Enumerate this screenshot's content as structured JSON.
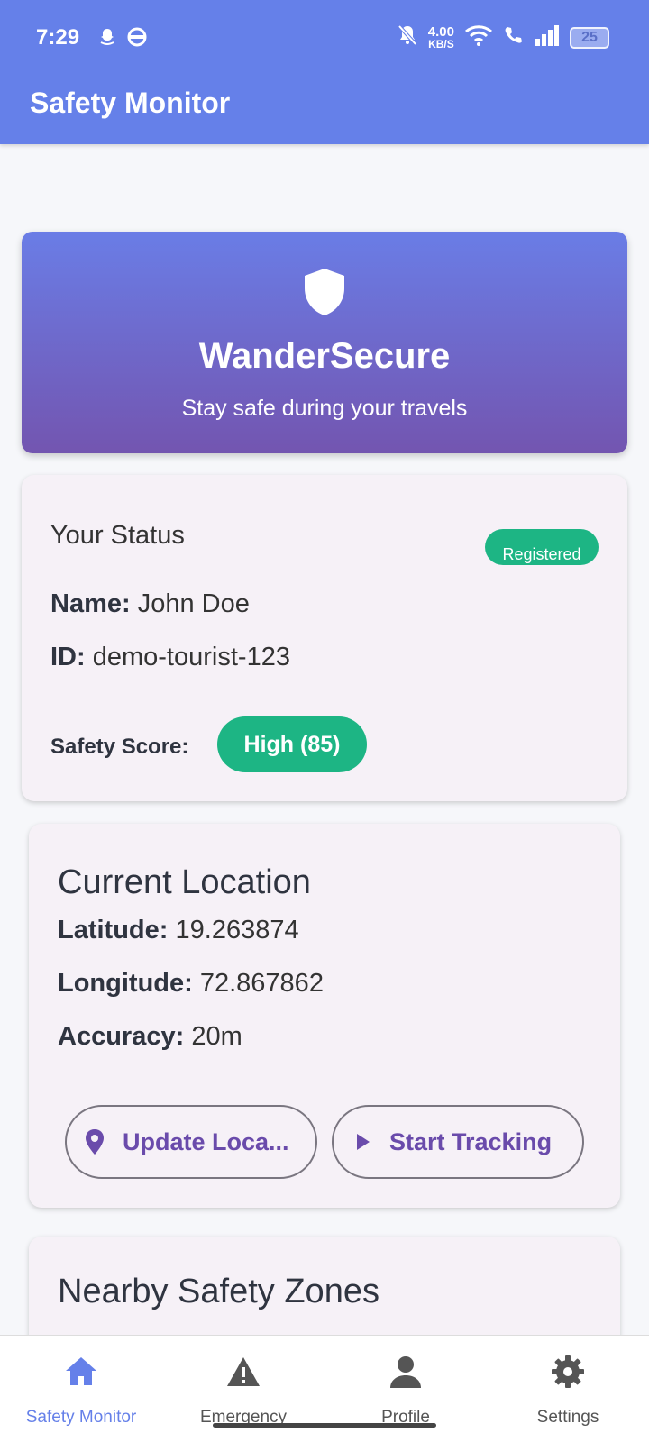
{
  "status_bar": {
    "time": "7:29",
    "net_speed_value": "4.00",
    "net_speed_unit": "KB/S",
    "battery": "25",
    "network_type": "5"
  },
  "app_bar": {
    "title": "Safety Monitor"
  },
  "hero": {
    "title": "WanderSecure",
    "subtitle": "Stay safe during your travels",
    "icon": "shield-icon"
  },
  "status_card": {
    "heading": "Your Status",
    "badge": "Registered",
    "name_label": "Name:",
    "name_value": "John Doe",
    "id_label": "ID:",
    "id_value": "demo-tourist-123",
    "score_label": "Safety Score:",
    "score_value": "High (85)"
  },
  "location_card": {
    "heading": "Current Location",
    "latitude_label": "Latitude:",
    "latitude_value": "19.263874",
    "longitude_label": "Longitude:",
    "longitude_value": "72.867862",
    "accuracy_label": "Accuracy:",
    "accuracy_value": "20m",
    "update_button": "Update Loca...",
    "track_button": "Start Tracking"
  },
  "zones_card": {
    "heading": "Nearby Safety Zones"
  },
  "bottom_nav": {
    "items": [
      {
        "label": "Safety Monitor",
        "icon": "home-icon",
        "active": true
      },
      {
        "label": "Emergency",
        "icon": "warning-icon",
        "active": false
      },
      {
        "label": "Profile",
        "icon": "person-icon",
        "active": false
      },
      {
        "label": "Settings",
        "icon": "gear-icon",
        "active": false
      }
    ]
  },
  "colors": {
    "primary": "#6580e9",
    "accent_purple": "#6a4bab",
    "success_green": "#1db584"
  }
}
